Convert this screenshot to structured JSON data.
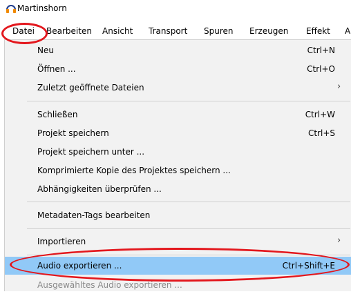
{
  "window": {
    "title": "Martinshorn",
    "icon": "headphones-icon"
  },
  "menubar": [
    {
      "label": "Datei",
      "active": true
    },
    {
      "label": "Bearbeiten"
    },
    {
      "label": "Ansicht"
    },
    {
      "label": "Transport"
    },
    {
      "label": "Spuren"
    },
    {
      "label": "Erzeugen"
    },
    {
      "label": "Effekt"
    },
    {
      "label": "A"
    }
  ],
  "menu": {
    "items": [
      {
        "label": "Neu",
        "shortcut": "Ctrl+N"
      },
      {
        "label": "Öffnen ...",
        "shortcut": "Ctrl+O"
      },
      {
        "label": "Zuletzt geöffnete Dateien",
        "submenu": "›"
      },
      {
        "label": "Schließen",
        "shortcut": "Ctrl+W"
      },
      {
        "label": "Projekt speichern",
        "shortcut": "Ctrl+S"
      },
      {
        "label": "Projekt speichern unter ..."
      },
      {
        "label": "Komprimierte Kopie des Projektes speichern ..."
      },
      {
        "label": "Abhängigkeiten überprüfen ..."
      },
      {
        "label": "Metadaten-Tags bearbeiten"
      },
      {
        "label": "Importieren",
        "submenu": "›"
      },
      {
        "label": "Audio exportieren ...",
        "shortcut": "Ctrl+Shift+E",
        "highlighted": true
      },
      {
        "label": "Ausgewähltes Audio exportieren ...",
        "disabled": true
      }
    ]
  },
  "colors": {
    "highlight": "#91c9f7",
    "annotation_ring": "#e3171d",
    "menu_bg": "#f2f2f2"
  }
}
